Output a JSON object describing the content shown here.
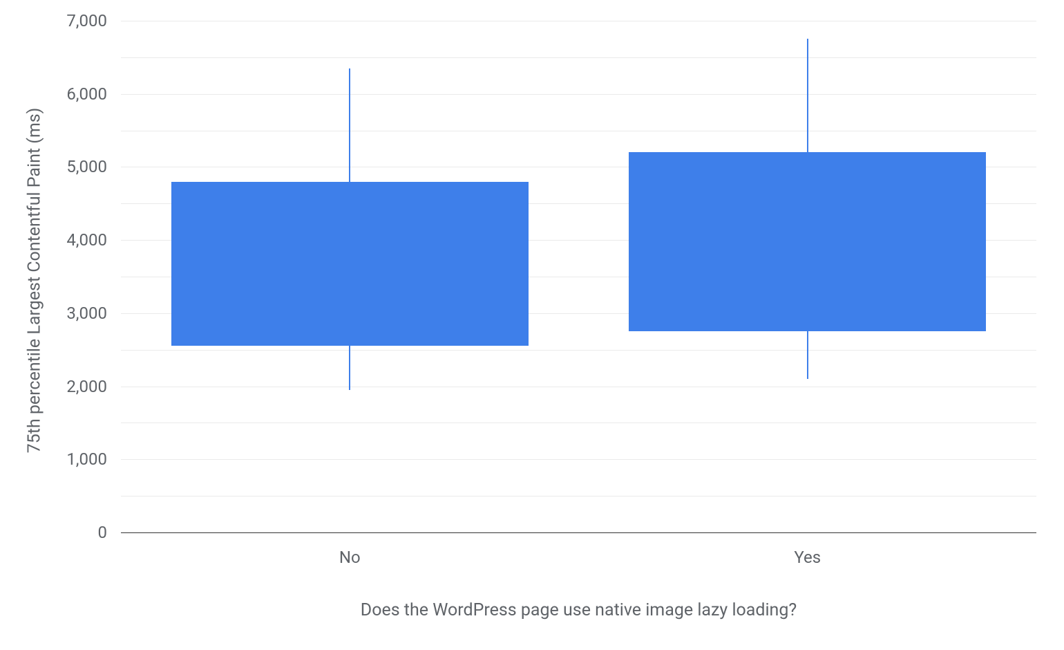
{
  "chart_data": {
    "type": "box",
    "xlabel": "Does the WordPress page use native image lazy loading?",
    "ylabel": "75th percentile Largest Contentful Paint (ms)",
    "ylim": [
      0,
      7000
    ],
    "y_ticks": [
      0,
      1000,
      2000,
      3000,
      4000,
      5000,
      6000,
      7000
    ],
    "y_tick_labels": [
      "0",
      "1,000",
      "2,000",
      "3,000",
      "4,000",
      "5,000",
      "6,000",
      "7,000"
    ],
    "minor_gridlines": [
      500,
      1500,
      2500,
      3500,
      4500,
      5500,
      6500
    ],
    "categories": [
      "No",
      "Yes"
    ],
    "series": [
      {
        "name": "No",
        "whisker_low": 1950,
        "q1": 2550,
        "q3": 4800,
        "whisker_high": 6350
      },
      {
        "name": "Yes",
        "whisker_low": 2100,
        "q1": 2750,
        "q3": 5200,
        "whisker_high": 6750
      }
    ],
    "box_color": "#3e7fea"
  }
}
